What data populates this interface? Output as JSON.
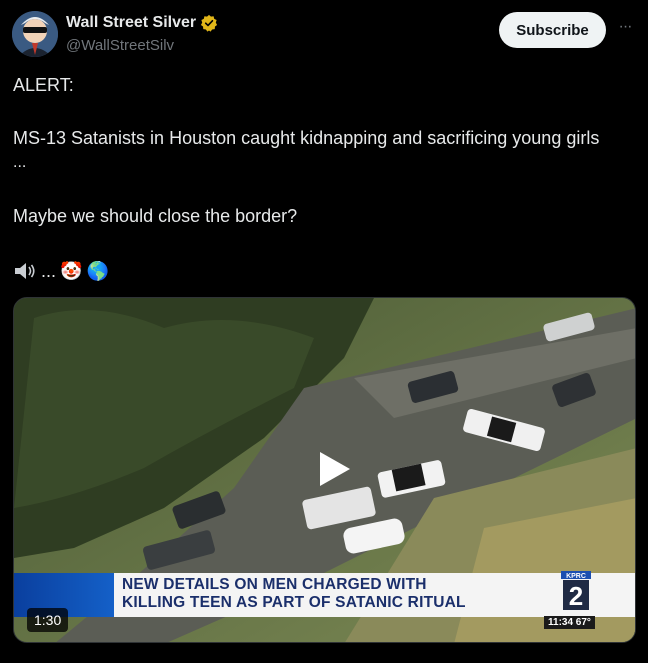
{
  "author": {
    "name": "Wall Street Silver",
    "handle": "@WallStreetSilv"
  },
  "header": {
    "subscribe_label": "Subscribe",
    "more_label": "···"
  },
  "tweet": {
    "line1": "ALERT:",
    "line2": "MS-13 Satanists in Houston caught kidnapping and sacrificing young girls",
    "line3": "...",
    "line4": "Maybe we should close the border?",
    "emoji_dots": "...",
    "emoji_clown": "🤡",
    "emoji_globe": "🌎"
  },
  "media": {
    "headline_line1": "NEW DETAILS ON MEN CHARGED WITH",
    "headline_line2": "KILLING TEEN AS PART OF SATANIC RITUAL",
    "station": "KPRC",
    "station_number": "2",
    "tv_clock": "11:34 67°",
    "duration": "1:30"
  },
  "colors": {
    "background": "#000000",
    "text": "#e7e9ea",
    "muted": "#71767b",
    "verified_gold": "#e2b719",
    "news_blue": "#1460c8"
  },
  "icons": [
    "avatar",
    "verified-badge-icon",
    "more-icon",
    "speaker-icon",
    "clown-emoji",
    "globe-emoji",
    "play-icon"
  ]
}
